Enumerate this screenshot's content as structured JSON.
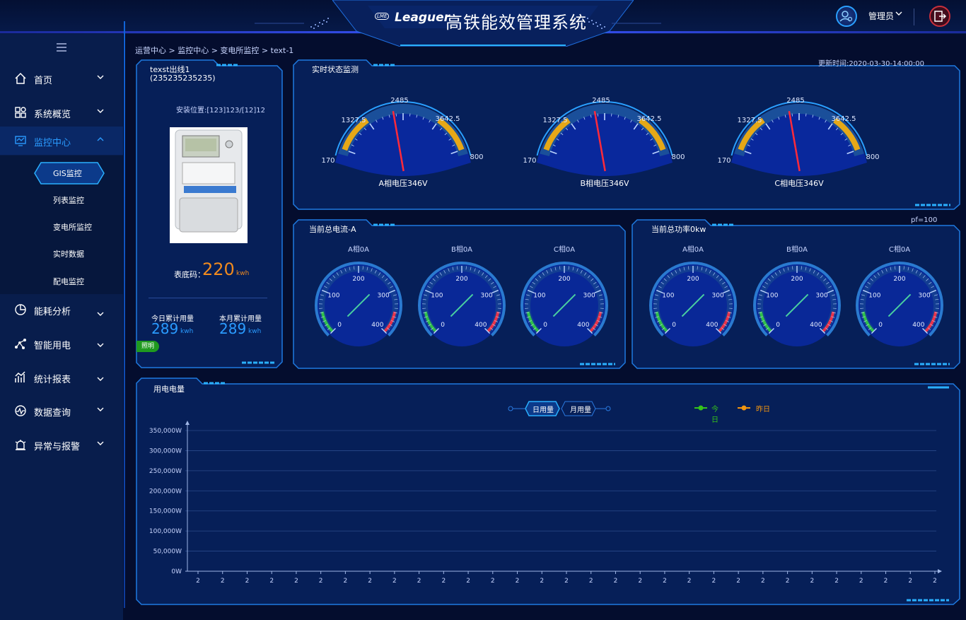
{
  "header": {
    "logo_text": "Leaguer",
    "logo_sub": "LME",
    "title": "高铁能效管理系统",
    "user_name": "管理员"
  },
  "sidebar": {
    "items": [
      {
        "label": "首页",
        "icon": "home-icon"
      },
      {
        "label": "系统概览",
        "icon": "grid-icon"
      },
      {
        "label": "监控中心",
        "icon": "monitor-icon"
      },
      {
        "label": "能耗分析",
        "icon": "pie-chart-icon"
      },
      {
        "label": "智能用电",
        "icon": "network-icon"
      },
      {
        "label": "统计报表",
        "icon": "bar-chart-icon"
      },
      {
        "label": "数据查询",
        "icon": "data-query-icon"
      },
      {
        "label": "异常与报警",
        "icon": "alarm-icon"
      }
    ],
    "submenu": [
      "GIS监控",
      "列表监控",
      "变电所监控",
      "实时数据",
      "配电监控"
    ]
  },
  "breadcrumb": "运营中心 > 监控中心 > 变电所监控 >  text-1",
  "meter_panel": {
    "title_line1": "texst出线1",
    "title_line2": "(235235235235)",
    "location": "安装位置:[123]123/[12]12",
    "reading_label": "表底码：",
    "reading_value": "220",
    "reading_unit": "kwh",
    "today_label": "今日累计用量",
    "today_value": "289",
    "today_unit": "kwh",
    "month_label": "本月累计用量",
    "month_value": "289",
    "month_unit": "kwh",
    "tag": "照明"
  },
  "realtime_panel": {
    "title": "实时状态监测",
    "update_time": "更新时间:2020-03-30-14:00:00",
    "gauges": [
      {
        "label": "A相电压346V",
        "value": 346
      },
      {
        "label": "B相电压346V",
        "value": 346
      },
      {
        "label": "C相电压346V",
        "value": 346
      }
    ],
    "scale": {
      "min": "170",
      "low": "1327.5",
      "mid": "2485",
      "high": "3642.5",
      "max": "800"
    }
  },
  "current_panel": {
    "title": "当前总电流-A",
    "gauges": [
      {
        "label": "A相0A",
        "value": 0
      },
      {
        "label": "B相0A",
        "value": 0
      },
      {
        "label": "C相0A",
        "value": 0
      }
    ]
  },
  "power_panel": {
    "title": "当前总功率0kw",
    "pf": "pf=100",
    "gauges": [
      {
        "label": "A相0A",
        "value": 0
      },
      {
        "label": "B相0A",
        "value": 0
      },
      {
        "label": "C相0A",
        "value": 0
      }
    ]
  },
  "small_gauge_scale": [
    "0",
    "100",
    "200",
    "300",
    "400"
  ],
  "usage_panel": {
    "title": "用电电量",
    "tabs": [
      "日用量",
      "月用量"
    ],
    "legend": [
      {
        "label": "今日",
        "color": "#35c31a"
      },
      {
        "label": "昨日",
        "color": "#f2950f"
      }
    ]
  },
  "chart_data": {
    "type": "line",
    "title": "用电电量",
    "ylim": [
      0,
      350000
    ],
    "yticks": [
      "0W",
      "50,000W",
      "100,000W",
      "150,000W",
      "200,000W",
      "250,000W",
      "300,000W",
      "350,000W"
    ],
    "categories": [
      "2",
      "2",
      "2",
      "2",
      "2",
      "2",
      "2",
      "2",
      "2",
      "2",
      "2",
      "2",
      "2",
      "2",
      "2",
      "2",
      "2",
      "2",
      "2",
      "2",
      "2",
      "2",
      "2",
      "2",
      "2",
      "2",
      "2",
      "2",
      "2",
      "2",
      "2"
    ],
    "series": [
      {
        "name": "今日",
        "values": []
      },
      {
        "name": "昨日",
        "values": []
      }
    ],
    "grid": true,
    "legend_position": "top-right"
  },
  "colors": {
    "accent": "#1e8cff",
    "value_orange": "#f08a1e",
    "value_blue": "#2a9bff",
    "tag_green": "#1f9a1f"
  }
}
